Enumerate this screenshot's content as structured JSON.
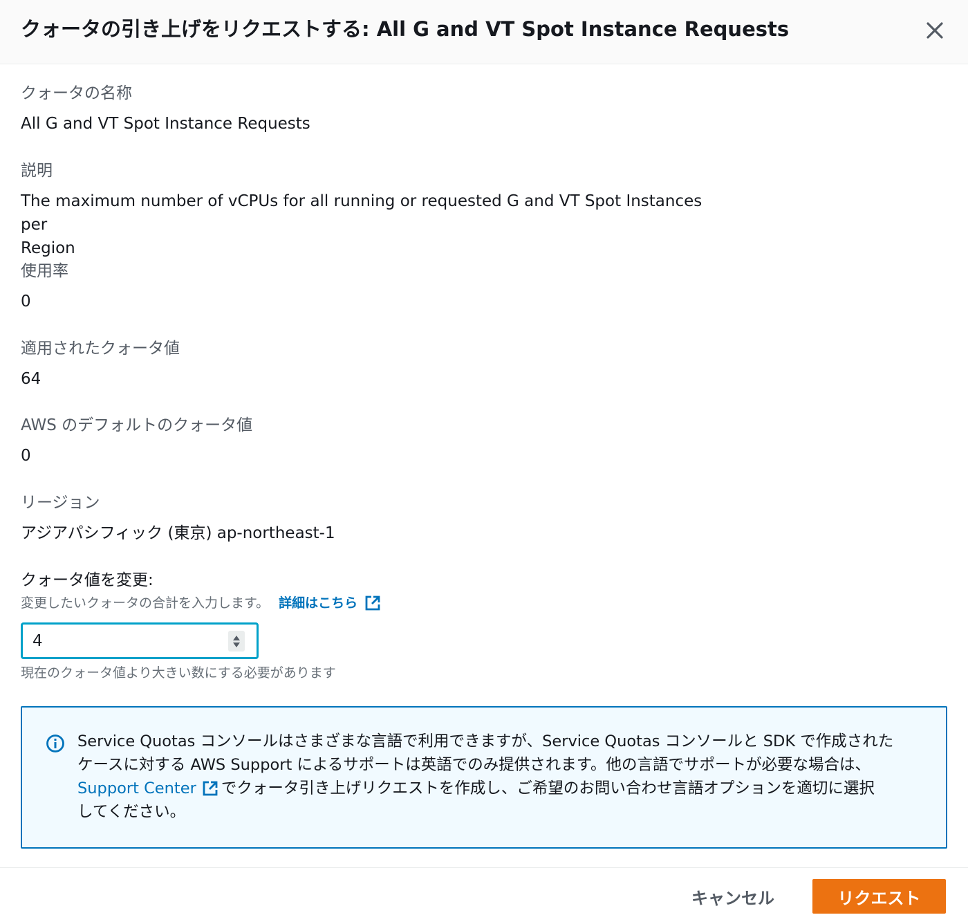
{
  "dialog": {
    "title": "クォータの引き上げをリクエストする: All G and VT Spot Instance Requests"
  },
  "details": {
    "quota_name_label": "クォータの名称",
    "quota_name_value": "All G and VT Spot Instance Requests",
    "description_label": "説明",
    "description_value_line1": "The maximum number of vCPUs for all running or requested G and VT Spot Instances per",
    "description_value_line2": "Region",
    "utilization_label": "使用率",
    "utilization_value": "0",
    "applied_quota_label": "適用されたクォータ値",
    "applied_quota_value": "64",
    "default_quota_label": "AWS のデフォルトのクォータ値",
    "default_quota_value": "0",
    "region_label": "リージョン",
    "region_value": "アジアパシフィック (東京) ap-northeast-1"
  },
  "form": {
    "label": "クォータ値を変更:",
    "description": "変更したいクォータの合計を入力します。",
    "learn_more_link": "詳細はこちら",
    "input_value": "4",
    "constraint_text": "現在のクォータ値より大きい数にする必要があります"
  },
  "info_alert": {
    "text_part1": "Service Quotas コンソールはさまざまな言語で利用できますが、Service Quotas コンソールと SDK で作成された",
    "text_part2": "ケースに対する AWS Support によるサポートは英語でのみ提供されます。他の言語でサポートが必要な場合は、",
    "link_text": "Support Center",
    "text_part3": "でクォータ引き上げリクエストを作成し、ご希望のお問い合わせ言語オプションを適切に選択",
    "text_part4": "してください。"
  },
  "footer": {
    "cancel_label": "キャンセル",
    "submit_label": "リクエスト"
  },
  "colors": {
    "primary_button": "#ec7211",
    "link": "#0073bb",
    "input_focus": "#00a1c9",
    "info_bg": "#f1faff"
  }
}
